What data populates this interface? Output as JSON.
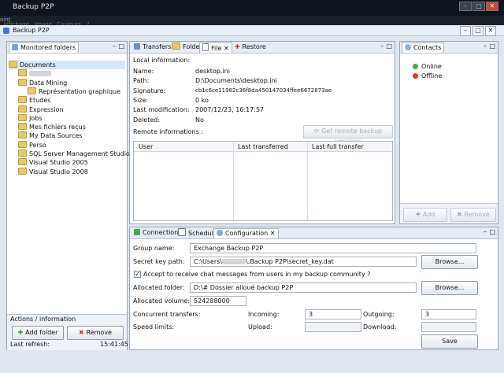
{
  "window": {
    "outer_title": "Backup P2P",
    "outer_menu_fragment": "oint",
    "outer_menu_items": [
      "Affichage",
      "Image",
      "Couleurs",
      "?"
    ],
    "app_title": "Backup P2P",
    "min_symbol": "–",
    "max_symbol": "□",
    "close_symbol": "✕"
  },
  "monitored": {
    "tab_label": "Monitored folders",
    "items": [
      {
        "label": "Documents",
        "indent": 0,
        "selected": true
      },
      {
        "label": "",
        "indent": 1,
        "blurred": true
      },
      {
        "label": "Data Mining",
        "indent": 1
      },
      {
        "label": "Représentation graphique",
        "indent": 2
      },
      {
        "label": "Etudes",
        "indent": 1
      },
      {
        "label": "Expression",
        "indent": 1
      },
      {
        "label": "Jobs",
        "indent": 1
      },
      {
        "label": "Mes fichiers reçus",
        "indent": 1
      },
      {
        "label": "My Data Sources",
        "indent": 1
      },
      {
        "label": "Perso",
        "indent": 1
      },
      {
        "label": "SQL Server Management Studio",
        "indent": 1
      },
      {
        "label": "Visual Studio 2005",
        "indent": 1
      },
      {
        "label": "Visual Studio 2008",
        "indent": 1
      }
    ],
    "actions_header": "Actions / information",
    "add_label": "Add folder",
    "remove_label": "Remove",
    "last_refresh_label": "Last refresh:",
    "last_refresh_value": "15:41:45"
  },
  "center_tabs": [
    {
      "label": "Transfers",
      "icon": "transfers-icon"
    },
    {
      "label": "Folder",
      "icon": "folder-icon"
    },
    {
      "label": "File",
      "icon": "file-icon",
      "active": true
    },
    {
      "label": "Restore",
      "icon": "restore-icon"
    }
  ],
  "file": {
    "local_header": "Local information:",
    "rows": [
      {
        "label": "Name:",
        "value": "desktop.ini"
      },
      {
        "label": "Path:",
        "value": "D:\\Documents\\desktop.ini"
      },
      {
        "label": "Signature:",
        "value": "cb1c6ce11982c36f8da450147034ffee6672873ae"
      },
      {
        "label": "Size:",
        "value": "0 ko"
      },
      {
        "label": "Last modification:",
        "value": "2007/12/23, 16:17:57"
      },
      {
        "label": "Deleted:",
        "value": "No"
      }
    ],
    "remote_header": "Remote informations :",
    "remote_button": "Get remote backup versions",
    "columns": [
      "User",
      "Last transferred",
      "Last full transfer"
    ]
  },
  "contacts": {
    "tab_label": "Contacts",
    "items": [
      {
        "label": "Online",
        "color": "#3fb13f"
      },
      {
        "label": "Offline",
        "color": "#d83a2b"
      }
    ],
    "add_label": "Add",
    "remove_label": "Remove"
  },
  "bottom_tabs": [
    {
      "label": "Connection",
      "icon": "connection-icon"
    },
    {
      "label": "Schedule",
      "icon": "schedule-icon"
    },
    {
      "label": "Configuration",
      "icon": "configuration-icon",
      "active": true
    }
  ],
  "config": {
    "group_label": "Group name:",
    "group_value": "Exchange Backup P2P",
    "secret_label": "Secret key path:",
    "secret_prefix": "C:\\Users\\",
    "secret_suffix": "\\.Backup P2P\\secret_key.dat",
    "browse_label": "Browse...",
    "accept_label": "Accept to receive chat messages from users in my backup community ?",
    "accept_checked": true,
    "allocated_folder_label": "Allocated folder:",
    "allocated_folder_value": "D:\\# Dossier alloué backup P2P",
    "allocated_volume_label": "Allocated volume:",
    "allocated_volume_value": "524288000",
    "concurrent_label": "Concurrent transfers:",
    "incoming_label": "Incoming:",
    "incoming_value": "3",
    "outgoing_label": "Outgoing:",
    "outgoing_value": "3",
    "speed_label": "Speed limits:",
    "upload_label": "Upload:",
    "upload_value": "",
    "download_label": "Download:",
    "download_value": "",
    "save_label": "Save"
  },
  "colors": {
    "selection": "#d7e6f7",
    "accent": "#2f64b0"
  }
}
